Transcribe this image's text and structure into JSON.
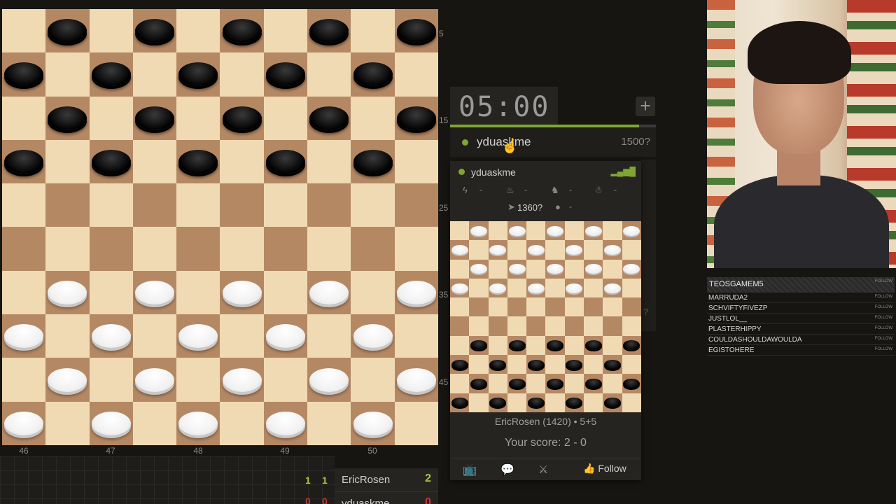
{
  "board": {
    "rows": [
      "_b_b_b_b_b",
      "b_b_b_b_b_",
      "_b_b_b_b_b",
      "b_b_b_b_b_",
      "__________",
      "__________",
      "_w_w_w_w_w",
      "w_w_w_w_w_",
      "_w_w_w_w_w",
      "w_w_w_w_w_"
    ],
    "row_numbers": [
      "5",
      "15",
      "25",
      "35",
      "45"
    ],
    "col_numbers": [
      "46",
      "47",
      "48",
      "49",
      "50"
    ]
  },
  "moves": {
    "row1": {
      "n1": "1",
      "n2": "1",
      "name": "EricRosen",
      "score": "2"
    },
    "row2": {
      "n1": "0",
      "n2": "0",
      "name": "yduaskme",
      "score": "0"
    }
  },
  "clock": {
    "time": "05:00",
    "plus": "+",
    "remaining_fraction": 0.92
  },
  "opponent": {
    "name": "yduaskme",
    "rating": "1500?"
  },
  "card": {
    "name": "yduaskme",
    "stats": [
      "-",
      "-",
      "-",
      "-",
      "-"
    ],
    "rating": "1360?",
    "mini_rows": [
      "_w_w_w_w_w",
      "w_w_w_w_w_",
      "_w_w_w_w_w",
      "w_w_w_w_w_",
      "__________",
      "__________",
      "_b_b_b_b_b",
      "b_b_b_b_b_",
      "_b_b_b_b_b",
      "b_b_b_b_b_"
    ],
    "game_info": "EricRosen (1420) • 5+5",
    "score": "Your score: 2 - 0",
    "follow": "Follow"
  },
  "follows": {
    "title": "TEOSGAMEM5",
    "follow_label": "FOLLOW",
    "items": [
      "MARRUDA2",
      "SCHVIFTYFIVEZP",
      "JUSTLOL__",
      "PLASTERHIPPY",
      "COULDASHOULDAWOULDA",
      "EGISTOHERE"
    ]
  },
  "faded_text": "?",
  "colors": {
    "accent": "#7fa632",
    "board_light": "#f0dab4",
    "board_dark": "#b58864"
  }
}
